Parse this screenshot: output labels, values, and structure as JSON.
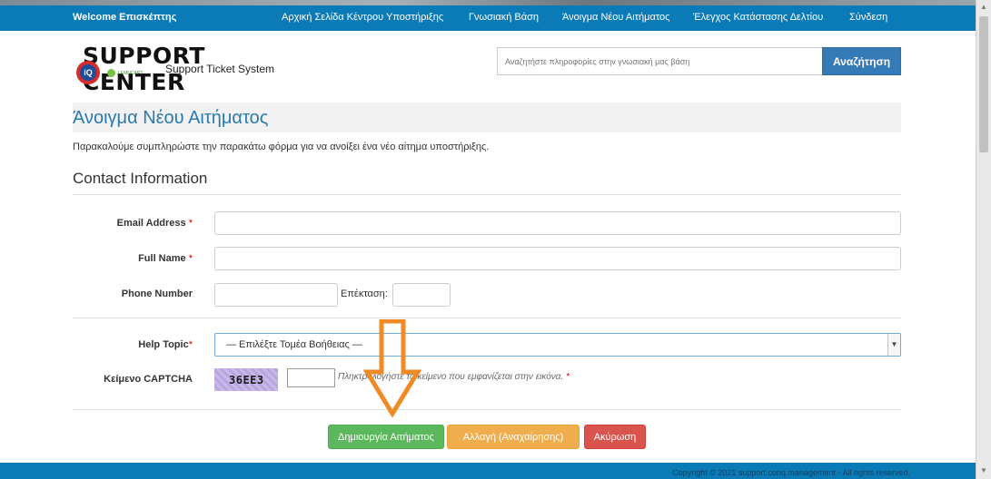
{
  "nav": {
    "welcome": "Welcome Επισκέπτης",
    "links": [
      "Αρχική Σελίδα Κέντρου Υποστήριξης",
      "Γνωσιακή Βάση",
      "Άνοιγμα Νέου Αιτήματος",
      "Έλεγχος Κατάστασης Δελτίου",
      "Σύνδεση"
    ]
  },
  "logo": {
    "title": "SUPPORT CENTER",
    "subtitle": "Support Ticket System",
    "badge_text": "iQ",
    "small_brand": "LEMNCART"
  },
  "search": {
    "placeholder": "Αναζητήστε πληροφορίες στην γνωσιακή μας βάση",
    "button": "Αναζήτηση"
  },
  "page": {
    "title": "Άνοιγμα Νέου Αιτήματος",
    "intro": "Παρακαλούμε συμπληρώστε την παρακάτω φόρμα για να ανοίξει ένα νέο αίτημα υποστήριξης.",
    "section": "Contact Information"
  },
  "form": {
    "email_label": "Email Address",
    "full_name_label": "Full Name",
    "phone_label": "Phone Number",
    "extension_label": "Επέκταση:",
    "required_mark": "*",
    "help_topic_label": "Help Topic",
    "help_topic_value": "— Επιλέξτε Τομέα Βοήθειας —",
    "captcha_label": "Κείμενο CAPTCHA",
    "captcha_code": "36EE3",
    "captcha_hint": "Πληκτρολογήστε το κείμενο που εμφανίζεται στην εικόνα."
  },
  "buttons": {
    "create": "Δημιουργία Αιτήματος",
    "reset": "Αλλαγή (Αναχαίρησης)",
    "cancel": "Ακύρωση"
  },
  "footer": {
    "copyright": "Copyright © 2021 support.conq.management - All rights reserved."
  },
  "colors": {
    "nav_bg": "#0b7bb7",
    "title_blue": "#2a7ab0",
    "success": "#5cb85c",
    "warning": "#f0ad4e",
    "danger": "#d9534f",
    "annotation_arrow": "#f08a24"
  }
}
